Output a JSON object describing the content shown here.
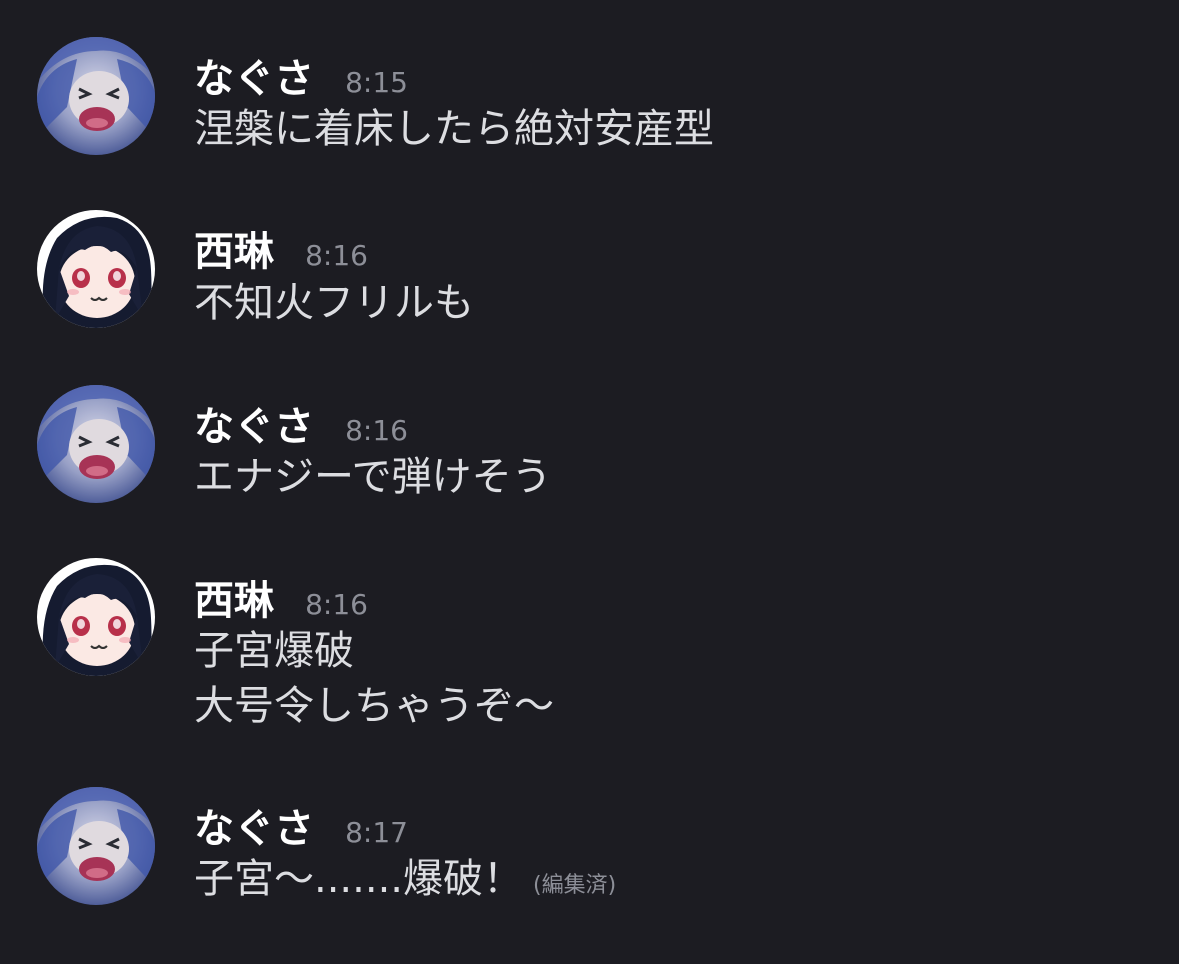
{
  "messages": [
    {
      "user": "なぐさ",
      "time": "8:15",
      "lines": [
        "涅槃に着床したら絶対安産型"
      ],
      "avatar": "nagusa-avatar"
    },
    {
      "user": "西琳",
      "time": "8:16",
      "lines": [
        "不知火フリルも"
      ],
      "avatar": "xilin-avatar"
    },
    {
      "user": "なぐさ",
      "time": "8:16",
      "lines": [
        "エナジーで弾けそう"
      ],
      "avatar": "nagusa-avatar"
    },
    {
      "user": "西琳",
      "time": "8:16",
      "lines": [
        "子宮爆破",
        "大号令しちゃうぞ〜"
      ],
      "avatar": "xilin-avatar"
    },
    {
      "user": "なぐさ",
      "time": "8:17",
      "lines": [
        "子宮〜.......爆破！"
      ],
      "edited": "(編集済)",
      "avatar": "nagusa-avatar"
    }
  ],
  "colors": {
    "background": "#1c1c22",
    "username": "#ffffff",
    "timestamp": "#8d8f98",
    "message_text": "#dcdde1"
  }
}
